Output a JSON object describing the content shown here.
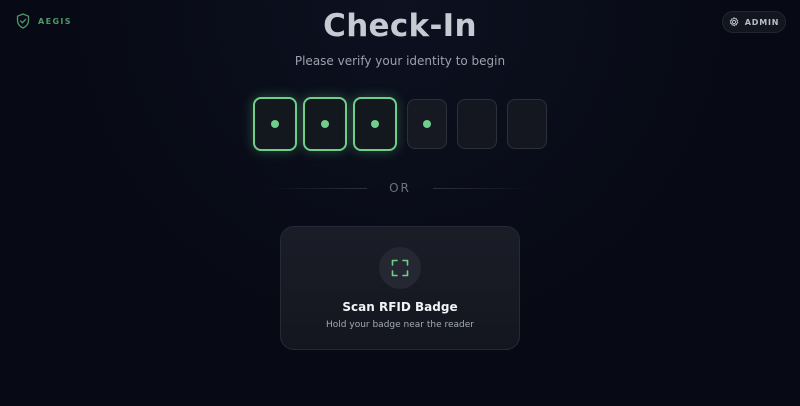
{
  "header": {
    "brand_name": "AEGIS",
    "brand_icon": "shield-icon",
    "admin_label": "ADMIN",
    "admin_icon": "gear-icon"
  },
  "main": {
    "title": "Check-In",
    "subtitle": "Please verify your identity to begin",
    "pin": {
      "length": 6,
      "entered": 4,
      "focused_count": 3
    },
    "divider_text": "OR",
    "rfid": {
      "title": "Scan RFID Badge",
      "subtitle": "Hold your badge near the reader",
      "icon": "scan-icon"
    }
  },
  "colors": {
    "accent": "#6fcf8a",
    "brand": "#4f9968",
    "background": "#070a14",
    "card": "#1a1d27"
  }
}
